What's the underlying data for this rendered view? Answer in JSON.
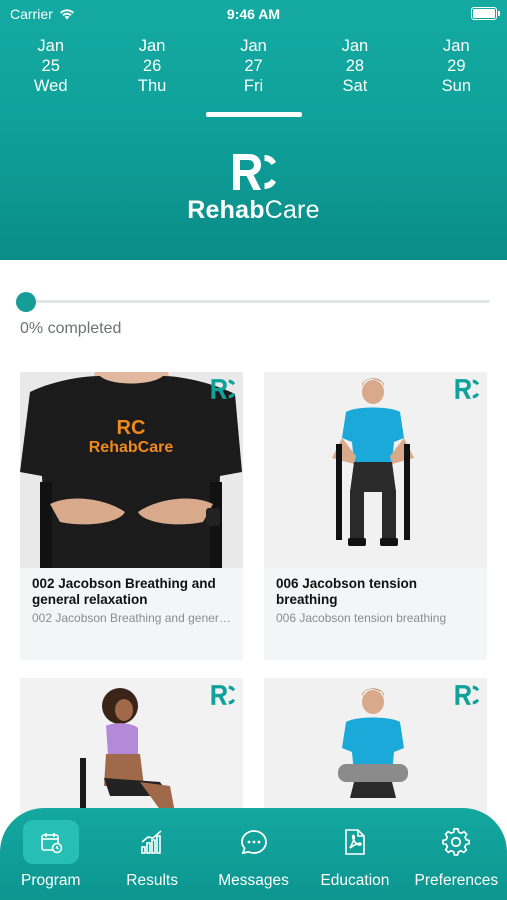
{
  "status_bar": {
    "carrier": "Carrier",
    "time": "9:46 AM"
  },
  "dates": [
    {
      "month": "Jan",
      "day": "25",
      "weekday": "Wed"
    },
    {
      "month": "Jan",
      "day": "26",
      "weekday": "Thu"
    },
    {
      "month": "Jan",
      "day": "27",
      "weekday": "Fri"
    },
    {
      "month": "Jan",
      "day": "28",
      "weekday": "Sat"
    },
    {
      "month": "Jan",
      "day": "29",
      "weekday": "Sun"
    }
  ],
  "selected_date_index": 2,
  "brand": {
    "name_part1": "Rehab",
    "name_part2": "Care",
    "color": "#0fa29b"
  },
  "progress": {
    "label": "0% completed",
    "fraction": 0
  },
  "exercises": [
    {
      "title": "002 Jacobson Breathing and general relaxation",
      "subtitle": "002 Jacobson Breathing and general relaxation"
    },
    {
      "title": "006 Jacobson tension breathing",
      "subtitle": "006 Jacobson tension breathing"
    },
    {
      "title": "",
      "subtitle": ""
    },
    {
      "title": "",
      "subtitle": ""
    }
  ],
  "tabs": [
    {
      "label": "Program",
      "icon": "calendar-icon",
      "active": true
    },
    {
      "label": "Results",
      "icon": "chart-icon",
      "active": false
    },
    {
      "label": "Messages",
      "icon": "message-icon",
      "active": false
    },
    {
      "label": "Education",
      "icon": "pdf-icon",
      "active": false
    },
    {
      "label": "Preferences",
      "icon": "gear-icon",
      "active": false
    }
  ]
}
